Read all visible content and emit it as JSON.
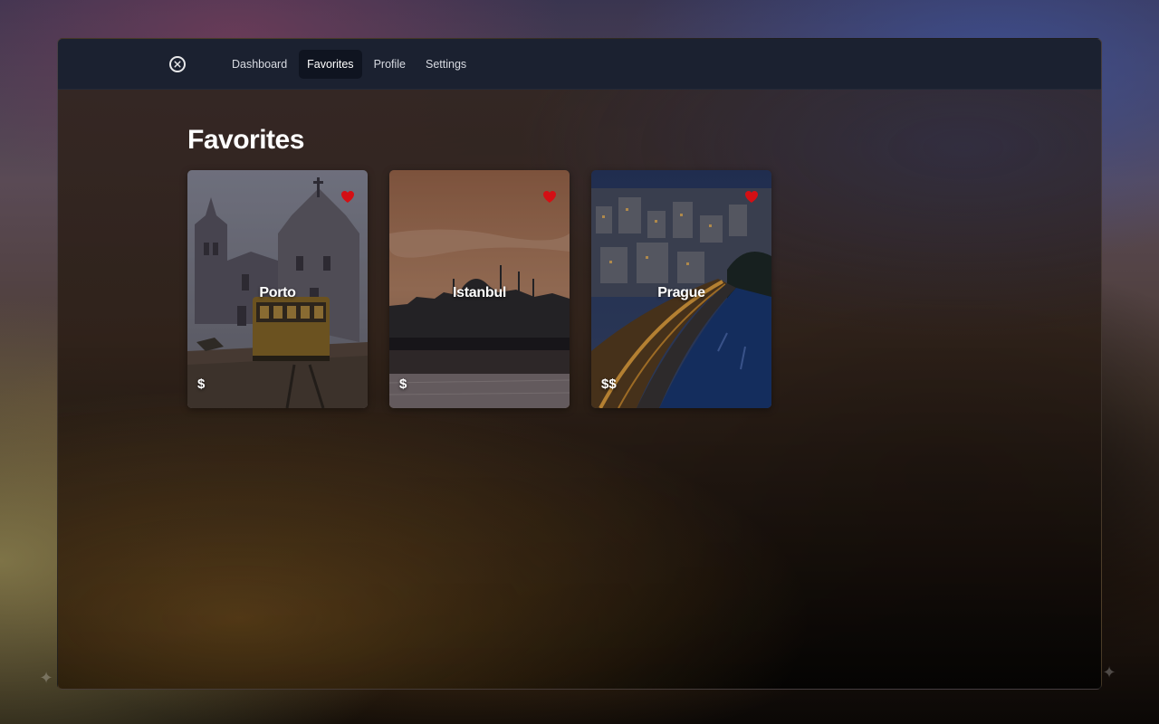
{
  "nav": {
    "items": [
      {
        "label": "Dashboard",
        "active": false
      },
      {
        "label": "Favorites",
        "active": true
      },
      {
        "label": "Profile",
        "active": false
      },
      {
        "label": "Settings",
        "active": false
      }
    ]
  },
  "page": {
    "title": "Favorites"
  },
  "favorites": [
    {
      "city": "Porto",
      "price": "$",
      "favorited": true
    },
    {
      "city": "Istanbul",
      "price": "$",
      "favorited": true
    },
    {
      "city": "Prague",
      "price": "$$",
      "favorited": true
    }
  ],
  "colors": {
    "navbar_bg": "#1b2130",
    "active_tab_bg": "#0f1420",
    "heart": "#d40f14",
    "text": "#ffffff"
  },
  "icons": {
    "close": "close-circle-icon",
    "favorite": "heart-icon"
  }
}
